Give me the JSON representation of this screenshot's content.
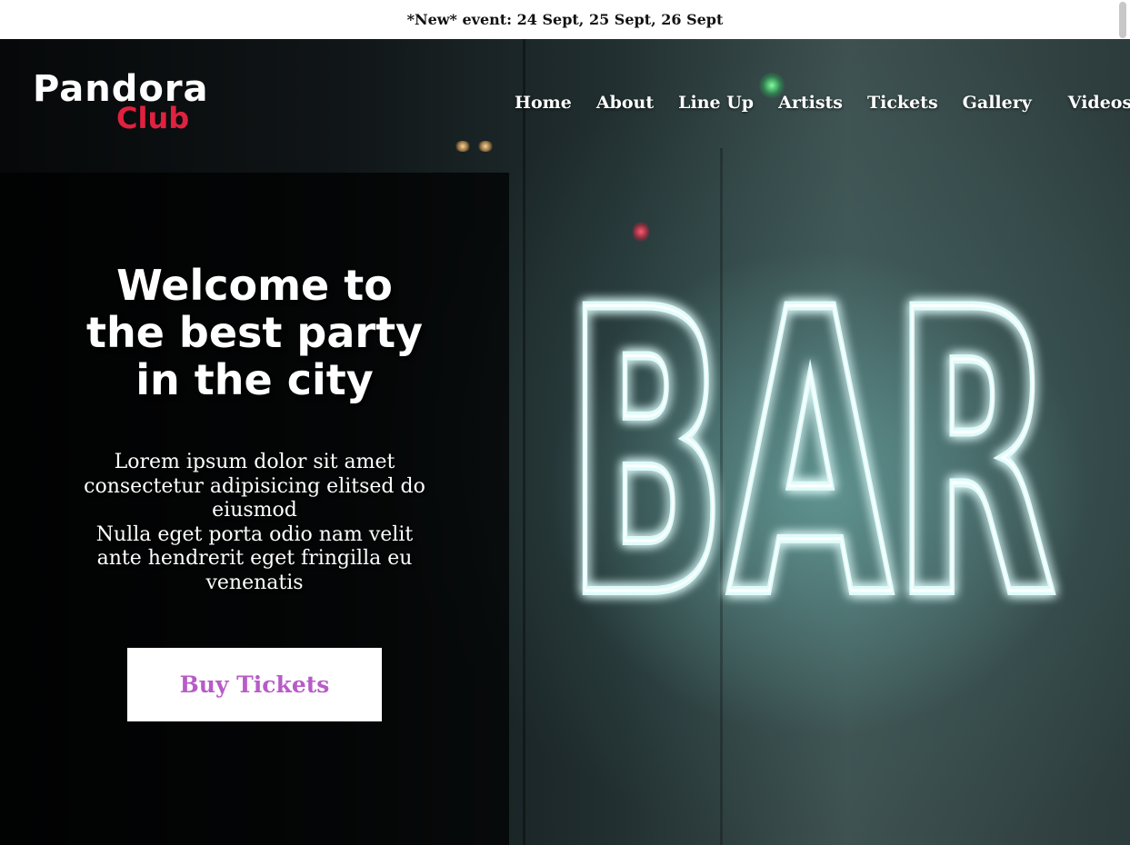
{
  "announcement": {
    "text": "*New* event: 24 Sept, 25 Sept, 26 Sept"
  },
  "logo": {
    "line1": "Pandora",
    "line2": "Club",
    "line2_color": "#e0213f"
  },
  "nav": {
    "items": [
      {
        "label": "Home"
      },
      {
        "label": "About"
      },
      {
        "label": "Line Up"
      },
      {
        "label": "Artists"
      },
      {
        "label": "Tickets"
      },
      {
        "label": "Gallery"
      },
      {
        "label": "Videos"
      }
    ]
  },
  "hero": {
    "headline": "Welcome to the best party in the city",
    "sub_lines": [
      "Lorem ipsum dolor sit amet consectetur adipisicing elitsed do eiusmod",
      "Nulla eget porta odio nam velit ante hendrerit eget fringilla eu venenatis"
    ],
    "cta_label": "Buy Tickets",
    "cta_color": "#b85bc8",
    "background_sign": "BAR"
  }
}
